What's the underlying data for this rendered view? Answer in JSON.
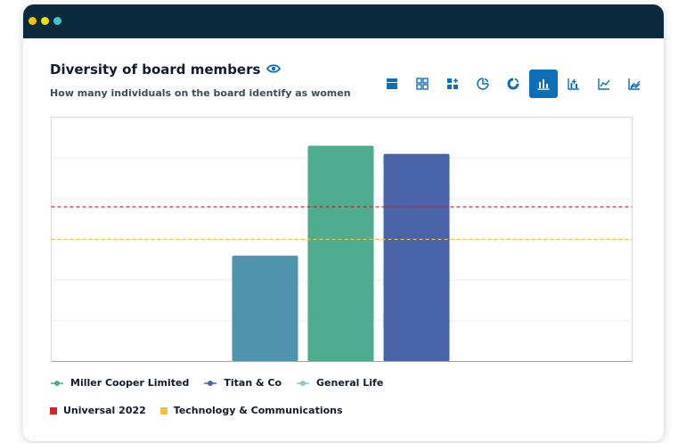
{
  "window": {
    "dots": [
      "#f5c400",
      "#f0e100",
      "#3fc7c7"
    ]
  },
  "header": {
    "title": "Diversity of board members",
    "subtitle": "How many individuals on the board identify as women",
    "title_icon": "eye-icon"
  },
  "toolbar": {
    "accent": "#0d6fb8",
    "icon_color": "#0d6fb8",
    "tools": [
      {
        "name": "single-panel-icon",
        "active": false
      },
      {
        "name": "grid-icon",
        "active": false
      },
      {
        "name": "grid-add-icon",
        "active": false
      },
      {
        "name": "pie-chart-icon",
        "active": false
      },
      {
        "name": "donut-chart-icon",
        "active": false
      },
      {
        "name": "bar-chart-icon",
        "active": true
      },
      {
        "name": "bar-chart-plus-icon",
        "active": false
      },
      {
        "name": "line-chart-icon",
        "active": false
      },
      {
        "name": "area-chart-icon",
        "active": false
      }
    ]
  },
  "chart_data": {
    "type": "bar",
    "title": "Diversity of board members",
    "subtitle": "How many individuals on the board identify as women",
    "ylim": [
      0,
      6
    ],
    "grid": true,
    "series": [
      {
        "name": "General Life",
        "value": 2.6,
        "color": "#4f93ad"
      },
      {
        "name": "Miller Cooper Limited",
        "value": 5.3,
        "color": "#4fac8e"
      },
      {
        "name": "Titan & Co",
        "value": 5.1,
        "color": "#4863a8"
      }
    ],
    "reference_lines": [
      {
        "name": "Universal 2022",
        "value": 3.8,
        "color": "#e02020",
        "style": "dashed"
      },
      {
        "name": "Technology & Communications",
        "value": 3.0,
        "color": "#f0c040",
        "style": "dashed"
      }
    ],
    "legend": [
      {
        "label": "Miller Cooper Limited",
        "color": "#4fac8e",
        "marker": "line-dot"
      },
      {
        "label": "Titan & Co",
        "color": "#4863a8",
        "marker": "line-dot"
      },
      {
        "label": "General Life",
        "color": "#8fc3d6",
        "marker": "line-dot"
      },
      {
        "label": "Universal 2022",
        "color": "#e02020",
        "marker": "square"
      },
      {
        "label": "Technology & Communications",
        "color": "#f0c040",
        "marker": "square"
      }
    ],
    "legend_placement": "bottom"
  }
}
